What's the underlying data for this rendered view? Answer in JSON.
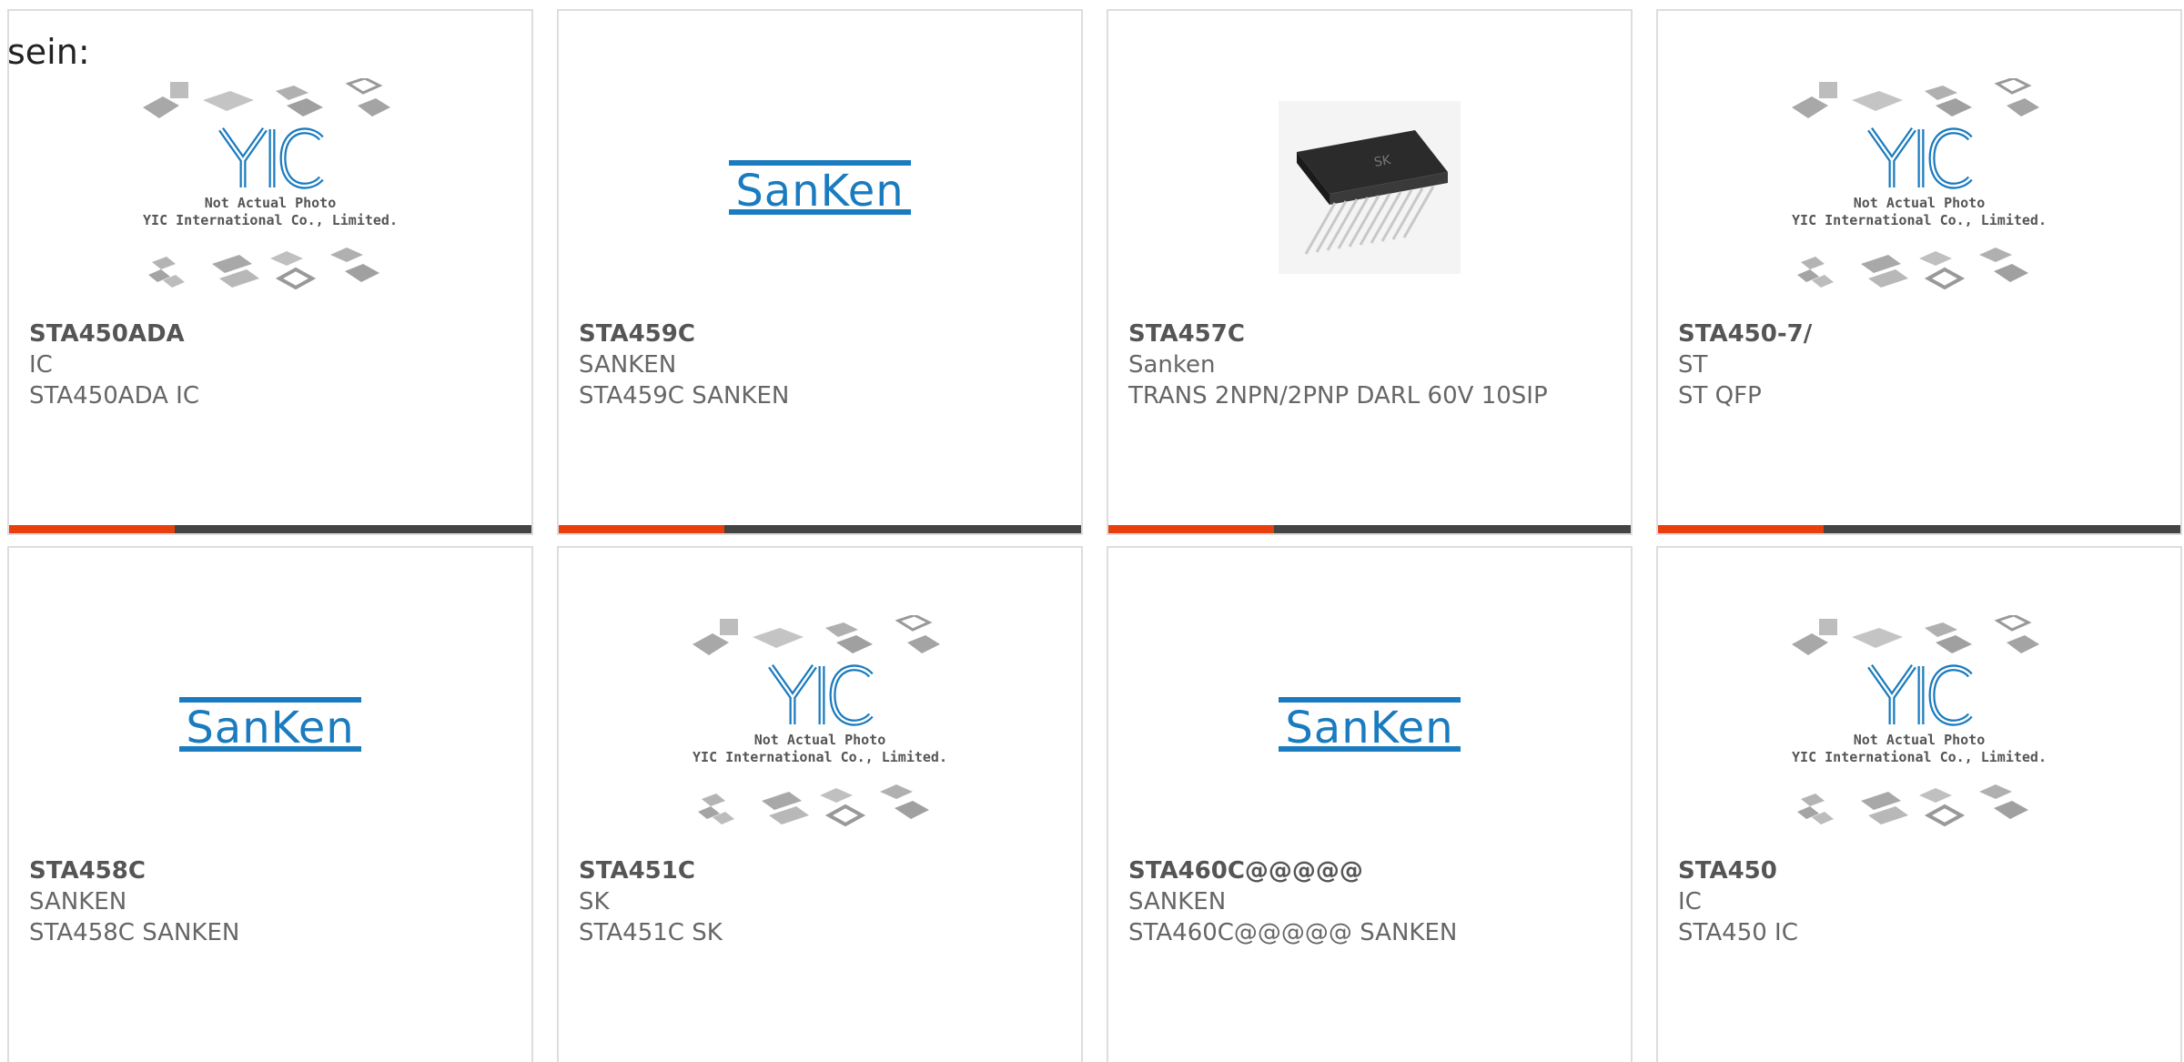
{
  "intro_text": "sein:",
  "cards": [
    {
      "part": "STA450ADA",
      "mfr": "IC",
      "desc": "STA450ADA IC",
      "image": "yic-placeholder"
    },
    {
      "part": "STA459C",
      "mfr": "SANKEN",
      "desc": "STA459C SANKEN",
      "image": "sanken-logo"
    },
    {
      "part": "STA457C",
      "mfr": "Sanken",
      "desc": "TRANS 2NPN/2PNP DARL 60V 10SIP",
      "image": "sip-chip-photo"
    },
    {
      "part": "STA450-7/",
      "mfr": "ST",
      "desc": "ST QFP",
      "image": "yic-placeholder"
    },
    {
      "part": "STA458C",
      "mfr": "SANKEN",
      "desc": "STA458C SANKEN",
      "image": "sanken-logo"
    },
    {
      "part": "STA451C",
      "mfr": "SK",
      "desc": "STA451C SK",
      "image": "yic-placeholder"
    },
    {
      "part": "STA460C@@@@@",
      "mfr": "SANKEN",
      "desc": "STA460C@@@@@ SANKEN",
      "image": "sanken-logo"
    },
    {
      "part": "STA450",
      "mfr": "IC",
      "desc": "STA450 IC",
      "image": "yic-placeholder"
    }
  ],
  "placeholder": {
    "line1": "Not Actual Photo",
    "line2": "YIC International Co., Limited.",
    "brand": "YIC"
  },
  "logo_text": "SanKen",
  "colors": {
    "accent": "#e8400c",
    "bar": "#444444",
    "logo_blue": "#1a7bbf"
  }
}
